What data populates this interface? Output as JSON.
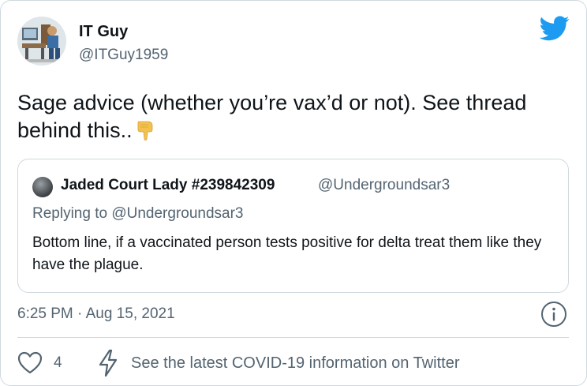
{
  "author": {
    "name": "IT Guy",
    "handle": "@ITGuy1959"
  },
  "tweet": {
    "text": "Sage advice (whether you’re vax’d or not). See thread behind this..",
    "emoji": "backhand-index-pointing-down"
  },
  "quote": {
    "name": "Jaded Court Lady #239842309",
    "handle": "@Undergroundsar3",
    "replying_to": "Replying to @Undergroundsar3",
    "text": "Bottom line, if a vaccinated person tests positive for delta treat them like they have the plague."
  },
  "timestamp": "6:25 PM · Aug 15, 2021",
  "actions": {
    "like_count": "4",
    "covid_link": "See the latest COVID-19 information on Twitter"
  },
  "colors": {
    "twitter_blue": "#1d9bf0",
    "secondary_text": "#536471",
    "border": "#cfd9de"
  },
  "icons": [
    "twitter-bird-icon",
    "info-icon",
    "heart-icon",
    "lightning-bolt-icon"
  ]
}
